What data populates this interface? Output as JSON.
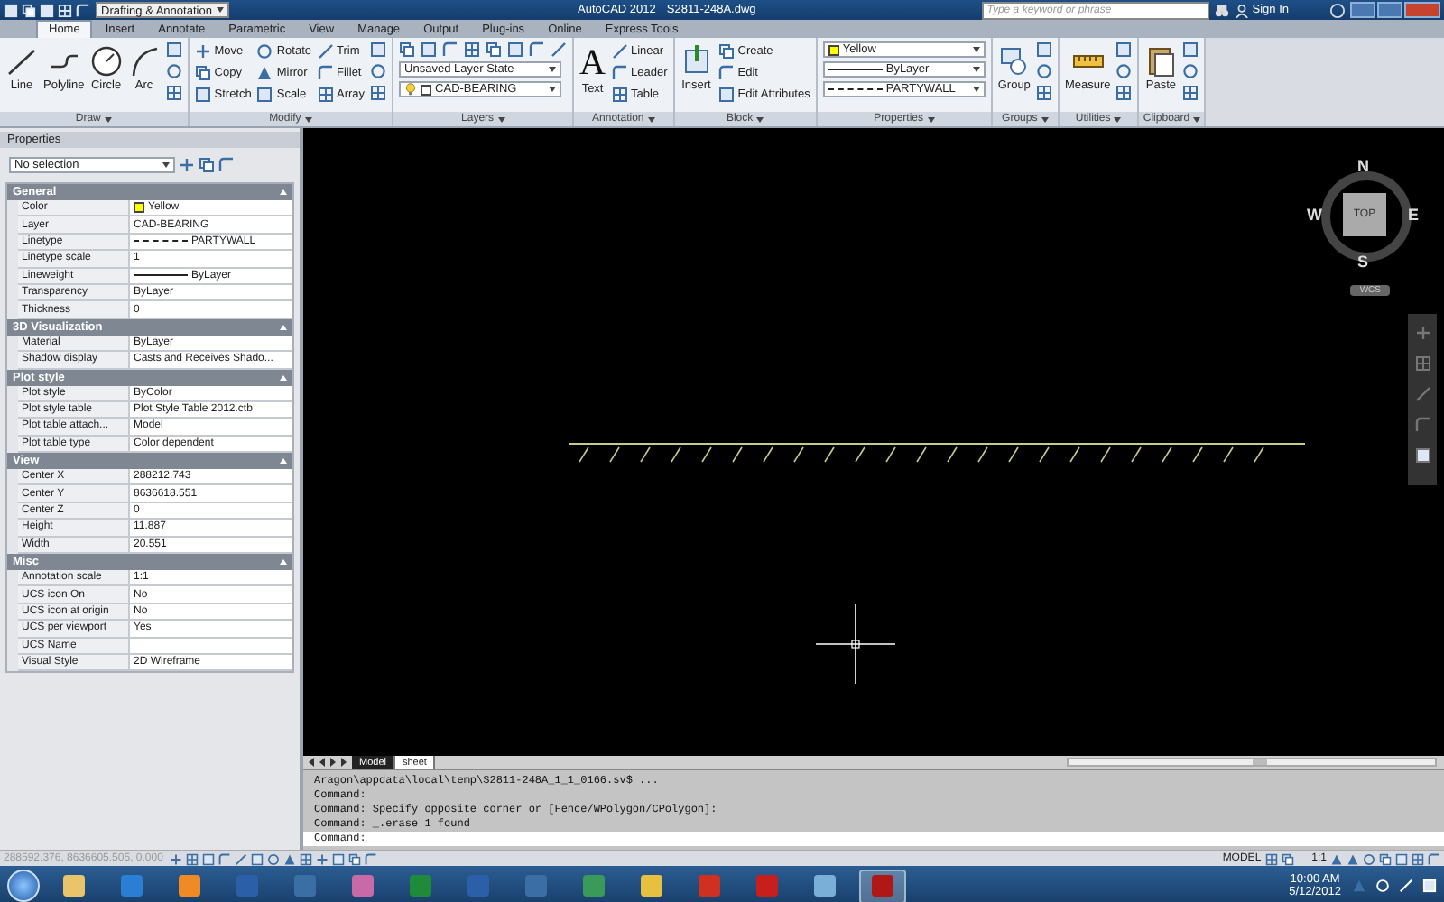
{
  "title_bar": {
    "workspace": "Drafting & Annotation",
    "app_title": "AutoCAD 2012",
    "file_name": "S2811-248A.dwg",
    "search": {
      "placeholder": "Type a keyword or phrase"
    },
    "sign_in": "Sign In"
  },
  "ribbon_tabs": [
    {
      "label": "Home",
      "selected": true
    },
    {
      "label": "Insert",
      "selected": false
    },
    {
      "label": "Annotate",
      "selected": false
    },
    {
      "label": "Parametric",
      "selected": false
    },
    {
      "label": "View",
      "selected": false
    },
    {
      "label": "Manage",
      "selected": false
    },
    {
      "label": "Output",
      "selected": false
    },
    {
      "label": "Plug-ins",
      "selected": false
    },
    {
      "label": "Online",
      "selected": false
    },
    {
      "label": "Express Tools",
      "selected": false
    }
  ],
  "ribbon_panels": [
    {
      "title": "Draw",
      "items": [
        {
          "kind": "large",
          "label": "Line"
        },
        {
          "kind": "large",
          "label": "Polyline"
        },
        {
          "kind": "large",
          "label": "Circle"
        },
        {
          "kind": "large",
          "label": "Arc"
        },
        {
          "kind": "icon_column"
        }
      ]
    },
    {
      "title": "Modify",
      "items": [
        {
          "kind": "column",
          "entries": [
            "Move",
            "Copy",
            "Stretch"
          ]
        },
        {
          "kind": "column",
          "entries": [
            "Rotate",
            "Mirror",
            "Scale"
          ]
        },
        {
          "kind": "column",
          "entries": [
            "Trim",
            "Fillet",
            "Array"
          ]
        },
        {
          "kind": "icon_column"
        }
      ]
    },
    {
      "title": "Layers",
      "items": [
        {
          "kind": "combo_stack",
          "entries": [
            {
              "kind": "icon_row"
            },
            {
              "kind": "combo",
              "value": "Unsaved Layer State"
            },
            {
              "kind": "layer",
              "value": "CAD-BEARING"
            }
          ]
        }
      ]
    },
    {
      "title": "Annotation",
      "items": [
        {
          "kind": "large",
          "label": "Text",
          "glyph": "A"
        },
        {
          "kind": "column",
          "entries": [
            "Linear",
            "Leader",
            "Table"
          ]
        }
      ]
    },
    {
      "title": "Block",
      "items": [
        {
          "kind": "large",
          "label": "Insert"
        },
        {
          "kind": "column",
          "entries": [
            "Create",
            "Edit",
            "Edit Attributes"
          ]
        }
      ]
    },
    {
      "title": "Properties",
      "items": [
        {
          "kind": "combo_stack",
          "entries": [
            {
              "kind": "swatch",
              "value": "Yellow",
              "color": "#ffff00"
            },
            {
              "kind": "solid",
              "value": "ByLayer"
            },
            {
              "kind": "dashed",
              "value": "PARTYWALL"
            }
          ]
        }
      ]
    },
    {
      "title": "Groups",
      "items": [
        {
          "kind": "large",
          "label": "Group"
        },
        {
          "kind": "icon_column"
        }
      ]
    },
    {
      "title": "Utilities",
      "items": [
        {
          "kind": "large",
          "label": "Measure"
        },
        {
          "kind": "icon_column"
        }
      ]
    },
    {
      "title": "Clipboard",
      "items": [
        {
          "kind": "large",
          "label": "Paste"
        },
        {
          "kind": "icon_column"
        }
      ]
    }
  ],
  "properties_palette": {
    "title": "Properties",
    "selection": "No selection",
    "sections": [
      {
        "title": "General",
        "expanded": true,
        "rows": [
          {
            "name": "Color",
            "value": "Yellow",
            "kind": "swatch",
            "color": "#ffff00"
          },
          {
            "name": "Layer",
            "value": "CAD-BEARING",
            "kind": "text"
          },
          {
            "name": "Linetype",
            "value": "PARTYWALL",
            "kind": "dashed"
          },
          {
            "name": "Linetype scale",
            "value": "1",
            "kind": "text"
          },
          {
            "name": "Lineweight",
            "value": "ByLayer",
            "kind": "solid"
          },
          {
            "name": "Transparency",
            "value": "ByLayer",
            "kind": "text"
          },
          {
            "name": "Thickness",
            "value": "0",
            "kind": "text"
          }
        ]
      },
      {
        "title": "3D Visualization",
        "expanded": true,
        "rows": [
          {
            "name": "Material",
            "value": "ByLayer",
            "kind": "text"
          },
          {
            "name": "Shadow display",
            "value": "Casts and Receives Shado...",
            "kind": "text"
          }
        ]
      },
      {
        "title": "Plot style",
        "expanded": true,
        "rows": [
          {
            "name": "Plot style",
            "value": "ByColor",
            "kind": "text"
          },
          {
            "name": "Plot style table",
            "value": "Plot Style Table 2012.ctb",
            "kind": "text"
          },
          {
            "name": "Plot table attach...",
            "value": "Model",
            "kind": "text"
          },
          {
            "name": "Plot table type",
            "value": "Color dependent",
            "kind": "text"
          }
        ]
      },
      {
        "title": "View",
        "expanded": true,
        "rows": [
          {
            "name": "Center X",
            "value": "288212.743",
            "kind": "text"
          },
          {
            "name": "Center Y",
            "value": "8636618.551",
            "kind": "text"
          },
          {
            "name": "Center Z",
            "value": "0",
            "kind": "text"
          },
          {
            "name": "Height",
            "value": "11.887",
            "kind": "text"
          },
          {
            "name": "Width",
            "value": "20.551",
            "kind": "text"
          }
        ]
      },
      {
        "title": "Misc",
        "expanded": true,
        "rows": [
          {
            "name": "Annotation scale",
            "value": "1:1",
            "kind": "text"
          },
          {
            "name": "UCS icon On",
            "value": "No",
            "kind": "text"
          },
          {
            "name": "UCS icon at origin",
            "value": "No",
            "kind": "text"
          },
          {
            "name": "UCS per viewport",
            "value": "Yes",
            "kind": "text"
          },
          {
            "name": "UCS Name",
            "kind": "text"
          },
          {
            "name": "Visual Style",
            "value": "2D Wireframe",
            "kind": "text"
          }
        ]
      }
    ]
  },
  "viewcube": {
    "face": "TOP",
    "north": "N",
    "east": "E",
    "south": "S",
    "west": "W",
    "ucs": "WCS"
  },
  "layout_tabs": [
    {
      "label": "Model",
      "selected": true
    },
    {
      "label": "sheet",
      "selected": false
    }
  ],
  "command_history": [
    "Aragon\\appdata\\local\\temp\\S2811-248A_1_1_0166.sv$ ...",
    "Command:",
    "Command: Specify opposite corner or [Fence/WPolygon/CPolygon]:",
    "Command: _.erase 1 found"
  ],
  "command_prompt": "Command:",
  "status_bar": {
    "coordinates": "288592.376, 8636605.505, 0.000",
    "space": "MODEL",
    "annotation_scale": "1:1"
  },
  "taskbar": {
    "time": "10:00 AM",
    "date": "5/12/2012"
  }
}
